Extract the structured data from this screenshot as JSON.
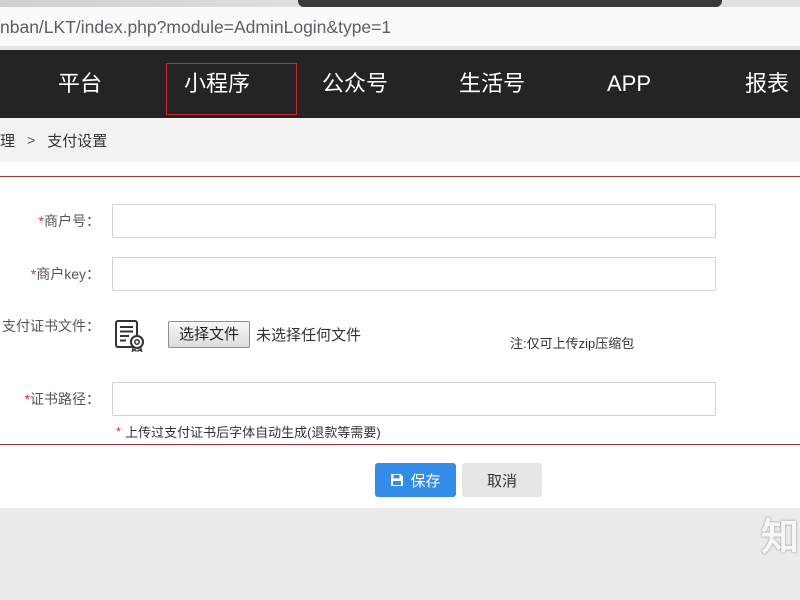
{
  "browser": {
    "url": "nban/LKT/index.php?module=AdminLogin&type=1"
  },
  "nav": {
    "items": [
      {
        "label": "平台"
      },
      {
        "label": "小程序",
        "highlighted": true
      },
      {
        "label": "公众号"
      },
      {
        "label": "生活号"
      },
      {
        "label": "APP"
      },
      {
        "label": "报表"
      }
    ]
  },
  "breadcrumb": {
    "parent": "理",
    "separator": ">",
    "current": "支付设置"
  },
  "form": {
    "merchant_id": {
      "required_mark": "*",
      "label": "商户号：",
      "value": ""
    },
    "merchant_key": {
      "required_mark": "*",
      "label": "商户key：",
      "value": ""
    },
    "certificate_file": {
      "label": "支付证书文件：",
      "icon": "certificate-document-icon",
      "choose_button_label": "选择文件",
      "file_status": "未选择任何文件",
      "note": "注:仅可上传zip压缩包"
    },
    "certificate_path": {
      "required_mark": "*",
      "label": "证书路径：",
      "value": "",
      "hint_mark": "*",
      "hint": "上传过支付证书后字体自动生成(退款等需要)"
    }
  },
  "actions": {
    "save": {
      "label": "保存",
      "icon": "save-icon"
    },
    "cancel": {
      "label": "取消"
    }
  },
  "watermark": "知",
  "colors": {
    "nav_background": "#242424",
    "annotation_red": "#c9272d",
    "panel_border": "#9c3434",
    "required_red": "#d0312d",
    "primary_blue": "#338ce8",
    "cancel_gray": "#e6e6e6",
    "breadcrumb_background": "#f2f2f2",
    "page_bottom_background": "#ebebeb"
  }
}
